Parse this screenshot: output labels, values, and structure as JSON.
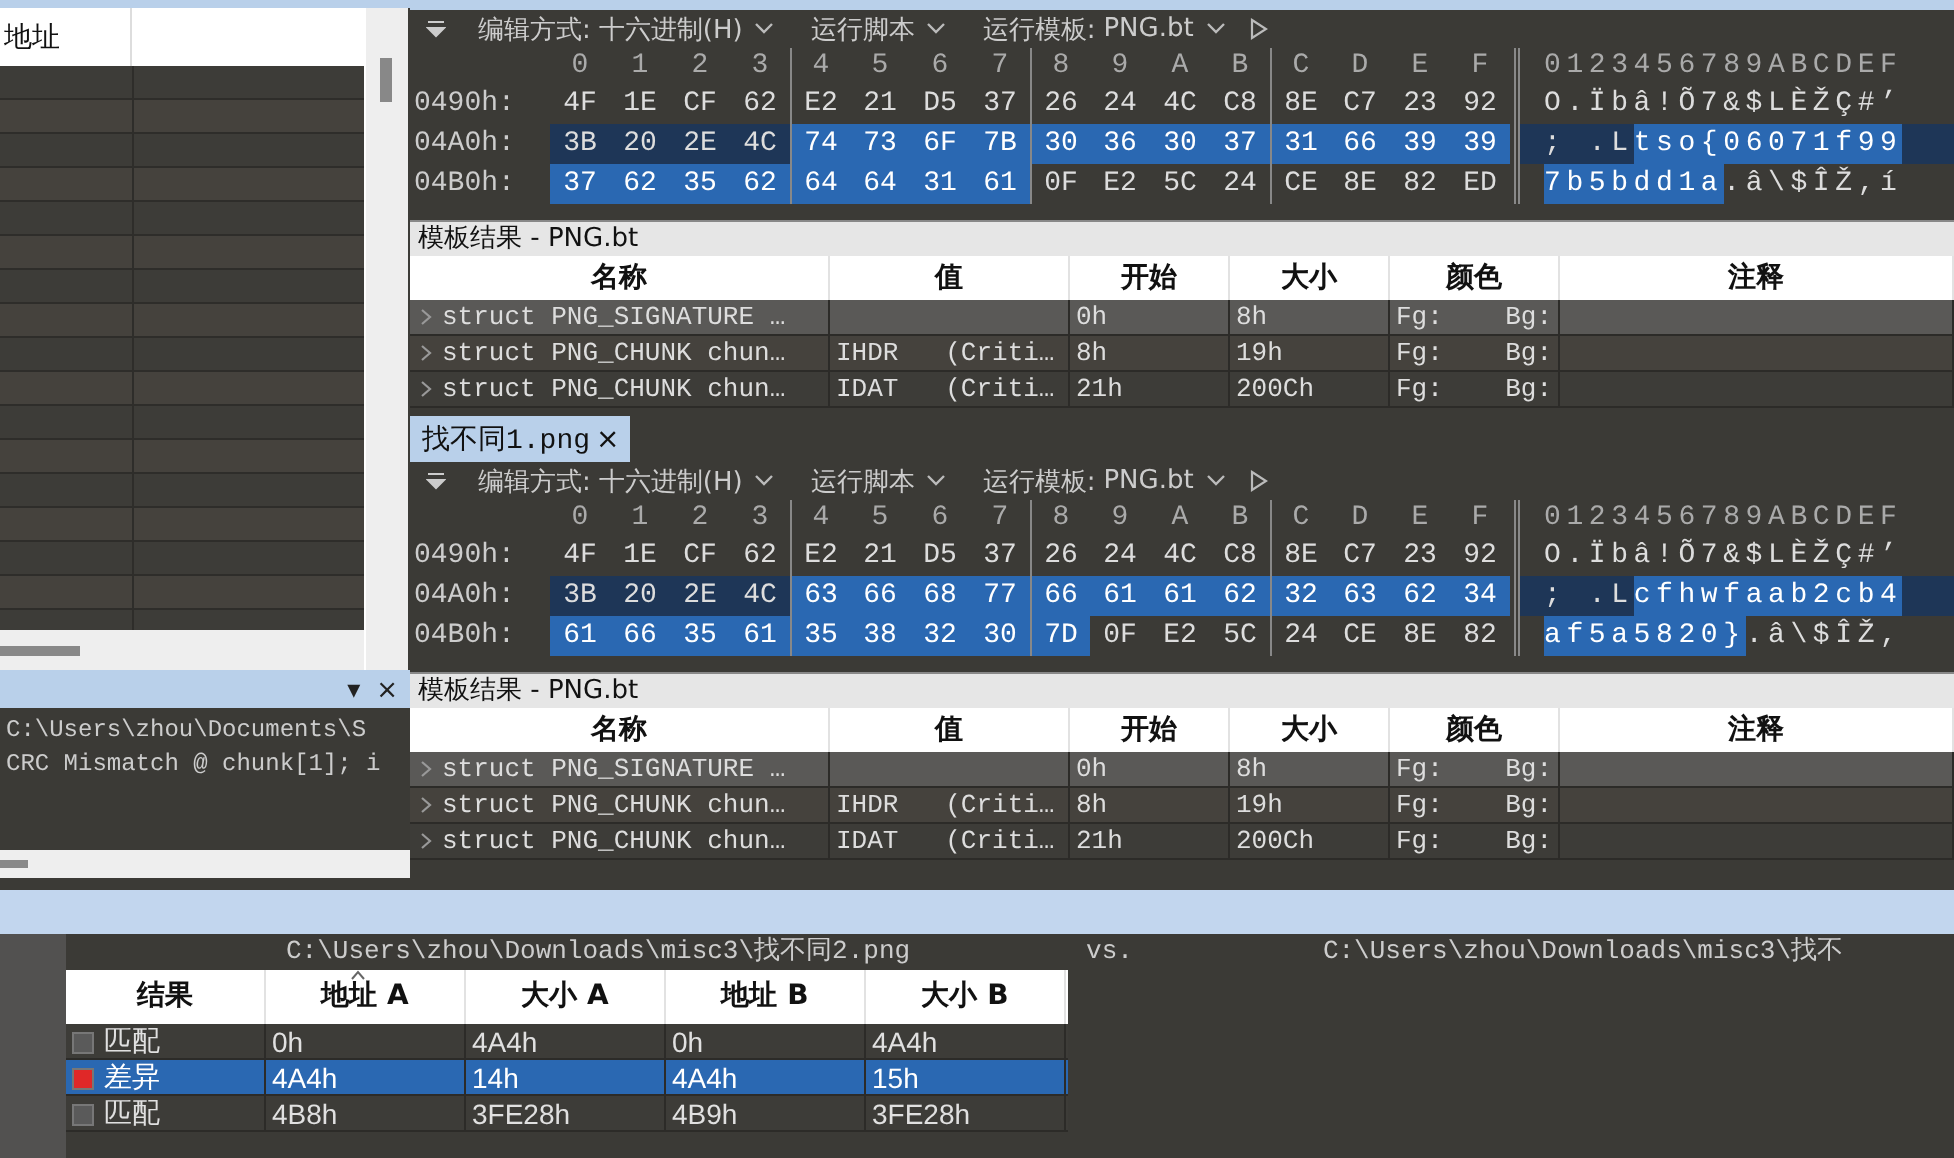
{
  "left_panel": {
    "header": "地址"
  },
  "output_panel": {
    "menu_glyph": "▾",
    "close_glyph": "×",
    "lines": [
      "C:\\Users\\zhou\\Documents\\S",
      "CRC Mismatch @ chunk[1]; i"
    ]
  },
  "editors": [
    {
      "toolbar": {
        "edit_mode_label": "编辑方式:",
        "edit_mode": "十六进制(H)",
        "run_script": "运行脚本",
        "run_template_label": "运行模板:",
        "template": "PNG.bt"
      },
      "column_labels": [
        "0",
        "1",
        "2",
        "3",
        "4",
        "5",
        "6",
        "7",
        "8",
        "9",
        "A",
        "B",
        "C",
        "D",
        "E",
        "F"
      ],
      "ascii_header": "0123456789ABCDEF",
      "rows": [
        {
          "offset": "0490h:",
          "current": false,
          "bytes": [
            {
              "v": "4F",
              "selected": false
            },
            {
              "v": "1E",
              "selected": false
            },
            {
              "v": "CF",
              "selected": false
            },
            {
              "v": "62",
              "selected": false
            },
            {
              "v": "E2",
              "selected": false
            },
            {
              "v": "21",
              "selected": false
            },
            {
              "v": "D5",
              "selected": false
            },
            {
              "v": "37",
              "selected": false
            },
            {
              "v": "26",
              "selected": false
            },
            {
              "v": "24",
              "selected": false
            },
            {
              "v": "4C",
              "selected": false
            },
            {
              "v": "C8",
              "selected": false
            },
            {
              "v": "8E",
              "selected": false
            },
            {
              "v": "C7",
              "selected": false
            },
            {
              "v": "23",
              "selected": false
            },
            {
              "v": "92",
              "selected": false
            }
          ],
          "ascii": [
            {
              "text": "O.Ïbâ!Õ7&$LÈŽÇ#’",
              "selected": false
            }
          ]
        },
        {
          "offset": "04A0h:",
          "current": true,
          "bytes": [
            {
              "v": "3B",
              "selected": false
            },
            {
              "v": "20",
              "selected": false
            },
            {
              "v": "2E",
              "selected": false
            },
            {
              "v": "4C",
              "selected": false
            },
            {
              "v": "74",
              "selected": true
            },
            {
              "v": "73",
              "selected": true
            },
            {
              "v": "6F",
              "selected": true
            },
            {
              "v": "7B",
              "selected": true
            },
            {
              "v": "30",
              "selected": true
            },
            {
              "v": "36",
              "selected": true
            },
            {
              "v": "30",
              "selected": true
            },
            {
              "v": "37",
              "selected": true
            },
            {
              "v": "31",
              "selected": true
            },
            {
              "v": "66",
              "selected": true
            },
            {
              "v": "39",
              "selected": true
            },
            {
              "v": "39",
              "selected": true
            }
          ],
          "ascii": [
            {
              "text": "; .L",
              "selected": false
            },
            {
              "text": "tso{06071f99",
              "selected": true
            }
          ]
        },
        {
          "offset": "04B0h:",
          "current": false,
          "bytes": [
            {
              "v": "37",
              "selected": true
            },
            {
              "v": "62",
              "selected": true
            },
            {
              "v": "35",
              "selected": true
            },
            {
              "v": "62",
              "selected": true
            },
            {
              "v": "64",
              "selected": true
            },
            {
              "v": "64",
              "selected": true
            },
            {
              "v": "31",
              "selected": true
            },
            {
              "v": "61",
              "selected": true
            },
            {
              "v": "0F",
              "selected": false
            },
            {
              "v": "E2",
              "selected": false
            },
            {
              "v": "5C",
              "selected": false
            },
            {
              "v": "24",
              "selected": false
            },
            {
              "v": "CE",
              "selected": false
            },
            {
              "v": "8E",
              "selected": false
            },
            {
              "v": "82",
              "selected": false
            },
            {
              "v": "ED",
              "selected": false
            }
          ],
          "ascii": [
            {
              "text": "7b5bdd1a",
              "selected": true
            },
            {
              "text": ".â\\$ÎŽ,í",
              "selected": false
            }
          ]
        }
      ],
      "template": {
        "title": "模板结果 - PNG.bt",
        "columns": [
          "名称",
          "值",
          "开始",
          "大小",
          "颜色",
          "注释"
        ],
        "rows": [
          {
            "name": "struct PNG_SIGNATURE …",
            "value": "",
            "start": "0h",
            "size": "8h",
            "fg": "Fg:",
            "bg": "Bg:",
            "selected": true
          },
          {
            "name": "struct PNG_CHUNK chun…",
            "value": "IHDR   (Criti…",
            "start": "8h",
            "size": "19h",
            "fg": "Fg:",
            "bg": "Bg:",
            "selected": false
          },
          {
            "name": "struct PNG_CHUNK chun…",
            "value": "IDAT   (Criti…",
            "start": "21h",
            "size": "200Ch",
            "fg": "Fg:",
            "bg": "Bg:",
            "selected": false
          }
        ]
      }
    },
    {
      "tab": {
        "label": "找不同1.png",
        "close": "×",
        "selected": true
      },
      "toolbar": {
        "edit_mode_label": "编辑方式:",
        "edit_mode": "十六进制(H)",
        "run_script": "运行脚本",
        "run_template_label": "运行模板:",
        "template": "PNG.bt"
      },
      "column_labels": [
        "0",
        "1",
        "2",
        "3",
        "4",
        "5",
        "6",
        "7",
        "8",
        "9",
        "A",
        "B",
        "C",
        "D",
        "E",
        "F"
      ],
      "ascii_header": "0123456789ABCDEF",
      "rows": [
        {
          "offset": "0490h:",
          "current": false,
          "bytes": [
            {
              "v": "4F",
              "selected": false
            },
            {
              "v": "1E",
              "selected": false
            },
            {
              "v": "CF",
              "selected": false
            },
            {
              "v": "62",
              "selected": false
            },
            {
              "v": "E2",
              "selected": false
            },
            {
              "v": "21",
              "selected": false
            },
            {
              "v": "D5",
              "selected": false
            },
            {
              "v": "37",
              "selected": false
            },
            {
              "v": "26",
              "selected": false
            },
            {
              "v": "24",
              "selected": false
            },
            {
              "v": "4C",
              "selected": false
            },
            {
              "v": "C8",
              "selected": false
            },
            {
              "v": "8E",
              "selected": false
            },
            {
              "v": "C7",
              "selected": false
            },
            {
              "v": "23",
              "selected": false
            },
            {
              "v": "92",
              "selected": false
            }
          ],
          "ascii": [
            {
              "text": "O.Ïbâ!Õ7&$LÈŽÇ#’",
              "selected": false
            }
          ]
        },
        {
          "offset": "04A0h:",
          "current": true,
          "bytes": [
            {
              "v": "3B",
              "selected": false
            },
            {
              "v": "20",
              "selected": false
            },
            {
              "v": "2E",
              "selected": false
            },
            {
              "v": "4C",
              "selected": false
            },
            {
              "v": "63",
              "selected": true
            },
            {
              "v": "66",
              "selected": true
            },
            {
              "v": "68",
              "selected": true
            },
            {
              "v": "77",
              "selected": true
            },
            {
              "v": "66",
              "selected": true
            },
            {
              "v": "61",
              "selected": true
            },
            {
              "v": "61",
              "selected": true
            },
            {
              "v": "62",
              "selected": true
            },
            {
              "v": "32",
              "selected": true
            },
            {
              "v": "63",
              "selected": true
            },
            {
              "v": "62",
              "selected": true
            },
            {
              "v": "34",
              "selected": true
            }
          ],
          "ascii": [
            {
              "text": "; .L",
              "selected": false
            },
            {
              "text": "cfhwfaab2cb4",
              "selected": true
            }
          ]
        },
        {
          "offset": "04B0h:",
          "current": false,
          "bytes": [
            {
              "v": "61",
              "selected": true
            },
            {
              "v": "66",
              "selected": true
            },
            {
              "v": "35",
              "selected": true
            },
            {
              "v": "61",
              "selected": true
            },
            {
              "v": "35",
              "selected": true
            },
            {
              "v": "38",
              "selected": true
            },
            {
              "v": "32",
              "selected": true
            },
            {
              "v": "30",
              "selected": true
            },
            {
              "v": "7D",
              "selected": true
            },
            {
              "v": "0F",
              "selected": false
            },
            {
              "v": "E2",
              "selected": false
            },
            {
              "v": "5C",
              "selected": false
            },
            {
              "v": "24",
              "selected": false
            },
            {
              "v": "CE",
              "selected": false
            },
            {
              "v": "8E",
              "selected": false
            },
            {
              "v": "82",
              "selected": false
            }
          ],
          "ascii": [
            {
              "text": "af5a5820}",
              "selected": true
            },
            {
              "text": ".â\\$ÎŽ,",
              "selected": false
            }
          ]
        }
      ],
      "template": {
        "title": "模板结果 - PNG.bt",
        "columns": [
          "名称",
          "值",
          "开始",
          "大小",
          "颜色",
          "注释"
        ],
        "rows": [
          {
            "name": "struct PNG_SIGNATURE …",
            "value": "",
            "start": "0h",
            "size": "8h",
            "fg": "Fg:",
            "bg": "Bg:",
            "selected": true
          },
          {
            "name": "struct PNG_CHUNK chun…",
            "value": "IHDR   (Criti…",
            "start": "8h",
            "size": "19h",
            "fg": "Fg:",
            "bg": "Bg:",
            "selected": false
          },
          {
            "name": "struct PNG_CHUNK chun…",
            "value": "IDAT   (Criti…",
            "start": "21h",
            "size": "200Ch",
            "fg": "Fg:",
            "bg": "Bg:",
            "selected": false
          }
        ]
      }
    }
  ],
  "compare": {
    "left_path": "C:\\Users\\zhou\\Downloads\\misc3\\找不同2.png",
    "vs": "vs.",
    "right_path": "C:\\Users\\zhou\\Downloads\\misc3\\找不",
    "columns": [
      {
        "label": "结果",
        "sorted": false
      },
      {
        "label": "地址 A",
        "sorted": true
      },
      {
        "label": "大小 A",
        "sorted": false
      },
      {
        "label": "地址 B",
        "sorted": false
      },
      {
        "label": "大小 B",
        "sorted": false
      }
    ],
    "rows": [
      {
        "result": "匹配",
        "color": "#5a5a5a",
        "addr_a": "0h",
        "size_a": "4A4h",
        "addr_b": "0h",
        "size_b": "4A4h",
        "selected": false
      },
      {
        "result": "差异",
        "color": "#e02828",
        "addr_a": "4A4h",
        "size_a": "14h",
        "addr_b": "4A4h",
        "size_b": "15h",
        "selected": true
      },
      {
        "result": "匹配",
        "color": "#5a5a5a",
        "addr_a": "4B8h",
        "size_a": "3FE28h",
        "addr_b": "4B9h",
        "size_b": "3FE28h",
        "selected": false
      }
    ]
  }
}
